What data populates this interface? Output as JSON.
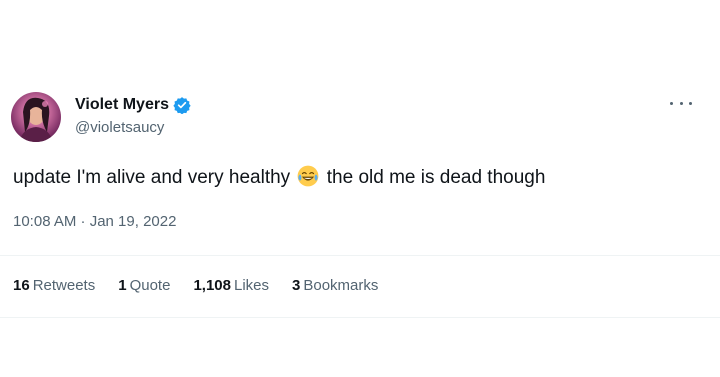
{
  "author": {
    "name": "Violet Myers",
    "handle": "@violetsaucy",
    "verified": true
  },
  "tweet": {
    "text_before_emoji": "update I'm alive and very healthy",
    "emoji": "face-with-tears-of-joy",
    "text_after_emoji": "the old me is dead though",
    "timestamp": "10:08 AM · Jan 19, 2022"
  },
  "stats": [
    {
      "count": "16",
      "label": "Retweets"
    },
    {
      "count": "1",
      "label": "Quote"
    },
    {
      "count": "1,108",
      "label": "Likes"
    },
    {
      "count": "3",
      "label": "Bookmarks"
    }
  ],
  "colors": {
    "text": "#0f1419",
    "secondary": "#536471",
    "verified": "#1d9bf0",
    "divider": "#eff3f4"
  }
}
